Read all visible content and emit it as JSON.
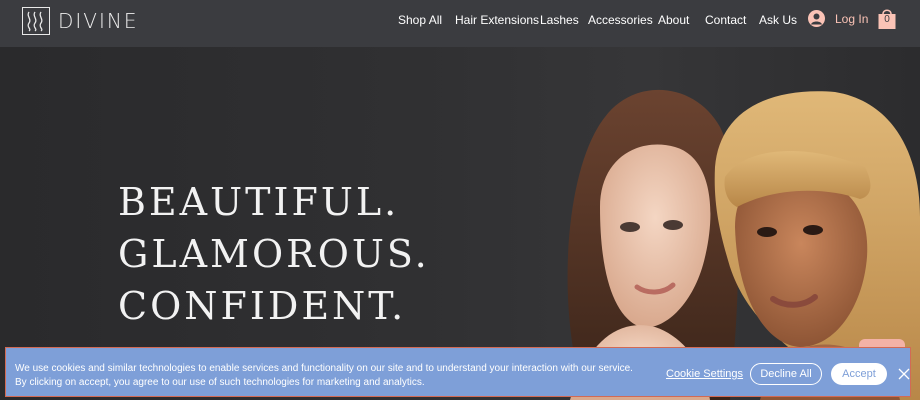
{
  "brand": {
    "name": "DIVINE"
  },
  "nav": {
    "items": [
      "Shop All",
      "Hair Extensions",
      "Lashes",
      "Accessories",
      "About",
      "Contact",
      "Ask Us"
    ],
    "login_label": "Log In",
    "cart_count": "0"
  },
  "hero": {
    "lines": [
      "BEAUTIFUL.",
      "GLAMOROUS.",
      "CONFIDENT."
    ]
  },
  "cookie": {
    "text_line1": "We use cookies and similar technologies to enable services and functionality on our site and to understand your interaction with our service.",
    "text_line2": "By clicking on accept, you agree to our use of such technologies for marketing and analytics.",
    "settings_label": "Cookie Settings",
    "decline_label": "Decline All",
    "accept_label": "Accept"
  },
  "colors": {
    "header_bg": "#3b3c40",
    "accent_pink": "#fbc3b6",
    "banner_bg": "#7e9fd8"
  },
  "icons": {
    "logo": "wavy-lines-logo-icon",
    "login": "user-avatar-icon",
    "cart": "shopping-bag-icon",
    "close": "close-icon"
  }
}
